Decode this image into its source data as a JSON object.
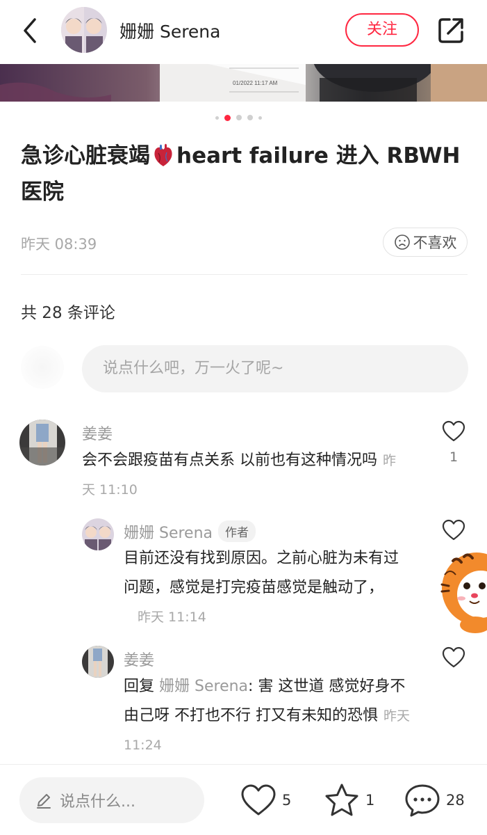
{
  "header": {
    "author_name": "姗姗 Serena",
    "follow_label": "关注"
  },
  "carousel": {
    "photo_caption": "01/2022 11:17 AM",
    "total_slides": 5,
    "active_slide": 2
  },
  "post": {
    "title_part1": "急诊心脏衰竭",
    "title_part2": "heart failure 进入 RBWH 医院",
    "time": "昨天 08:39",
    "dislike_label": "不喜欢"
  },
  "comments_section": {
    "count_label": "共 28 条评论",
    "input_placeholder": "说点什么吧，万一火了呢~"
  },
  "comments": [
    {
      "name": "姜姜",
      "text": "会不会跟疫苗有点关系 以前也有这种情况吗",
      "time": "昨天 11:10",
      "likes": "1"
    },
    {
      "name": "姗姗 Serena",
      "tag": "作者",
      "text": "目前还没有找到原因。之前心脏为未有过问题，感觉是打完疫苗感觉是触动了，",
      "time": "昨天 11:14"
    },
    {
      "name": "姜姜",
      "reply_prefix": "回复",
      "reply_to": "姗姗 Serena",
      "text": ": 害 这世道 感觉好身不由己呀 不打也不行 打又有未知的恐惧",
      "time": "昨天 11:24"
    }
  ],
  "bottom_bar": {
    "input_placeholder": "说点什么...",
    "likes": "5",
    "collects": "1",
    "comments": "28"
  },
  "colors": {
    "accent": "#ff2741",
    "muted_text": "#a8a8a8",
    "input_bg": "#f3f3f3"
  },
  "icons": [
    "back-arrow-icon",
    "share-icon",
    "heart-organ-emoji",
    "sad-face-icon",
    "heart-icon",
    "star-icon",
    "chat-bubble-icon",
    "pencil-icon"
  ]
}
